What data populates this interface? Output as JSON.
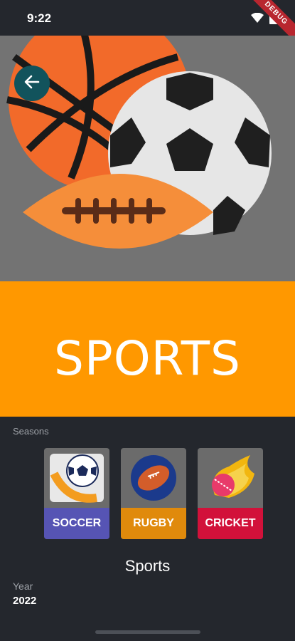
{
  "status_bar": {
    "time": "9:22",
    "debug_banner": "DEBUG"
  },
  "header": {
    "back_icon": "arrow-left-icon"
  },
  "hero": {
    "image": "sports-balls-illustration"
  },
  "title": {
    "text": "SPORTS",
    "band_color": "#ff9800"
  },
  "seasons": {
    "label": "Seasons",
    "items": [
      {
        "label": "SOCCER",
        "label_color": "#5654b4",
        "icon": "soccer-ball-icon"
      },
      {
        "label": "RUGBY",
        "label_color": "#e08a0c",
        "icon": "rugby-ball-icon"
      },
      {
        "label": "CRICKET",
        "label_color": "#d2113a",
        "icon": "cricket-ball-icon"
      }
    ]
  },
  "details": {
    "title": "Sports",
    "year_label": "Year",
    "year_value": "2022"
  }
}
